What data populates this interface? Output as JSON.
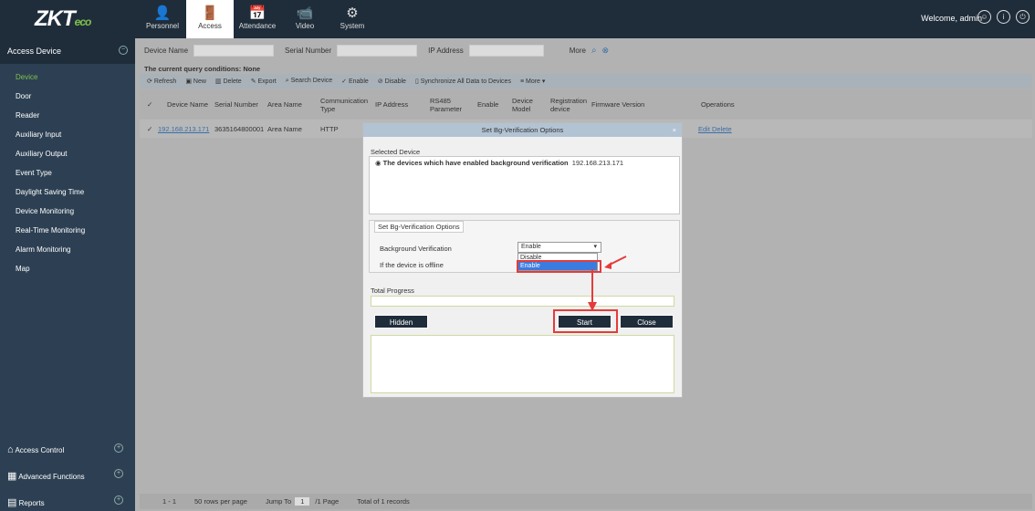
{
  "brand": {
    "logo_main": "ZKT",
    "logo_sub": "eco"
  },
  "topnav": [
    {
      "label": "Personnel",
      "icon": "👤"
    },
    {
      "label": "Access",
      "icon": "🚪"
    },
    {
      "label": "Attendance",
      "icon": "📅"
    },
    {
      "label": "Video",
      "icon": "📹"
    },
    {
      "label": "System",
      "icon": "⚙"
    }
  ],
  "welcome": "Welcome, admin",
  "sidebar": {
    "header": "Access Device",
    "items": [
      "Device",
      "Door",
      "Reader",
      "Auxiliary Input",
      "Auxiliary Output",
      "Event Type",
      "Daylight Saving Time",
      "Device Monitoring",
      "Real-Time Monitoring",
      "Alarm Monitoring",
      "Map"
    ],
    "footer": [
      "Access Control",
      "Advanced Functions",
      "Reports"
    ]
  },
  "search": {
    "device_name": "Device Name",
    "serial_number": "Serial Number",
    "ip_address": "IP Address",
    "more": "More"
  },
  "query": "The current query conditions:  None",
  "toolbar": [
    "Refresh",
    "New",
    "Delete",
    "Export",
    "Search Device",
    "Enable",
    "Disable",
    "Synchronize All Data to Devices",
    "More"
  ],
  "table": {
    "headers": [
      "Device Name",
      "Serial Number",
      "Area Name",
      "Communication Type",
      "IP Address",
      "RS485 Parameter",
      "Enable",
      "Device Model",
      "Registration device",
      "Firmware Version",
      "Operations"
    ],
    "row": {
      "device_name": "192.168.213.171",
      "serial": "3635164800001",
      "area": "Area Name",
      "comm": "HTTP",
      "ops": "Edit Delete"
    }
  },
  "footer": {
    "range": "1 - 1",
    "rows": "50 rows per page",
    "jump": "Jump To",
    "page_val": "1",
    "page": "/1 Page",
    "total": "Total of 1 records"
  },
  "dialog": {
    "title": "Set Bg-Verification Options",
    "selected_label": "Selected Device",
    "selected_text": "The devices which have enabled background verification",
    "selected_ip": "192.168.213.171",
    "options_legend": "Set Bg-Verification Options",
    "bg_label": "Background Verification",
    "offline_label": "If the device is offline",
    "select_value": "Enable",
    "options": [
      "Disable",
      "Enable"
    ],
    "progress_label": "Total Progress",
    "hidden_btn": "Hidden",
    "start_btn": "Start",
    "close_btn": "Close"
  }
}
